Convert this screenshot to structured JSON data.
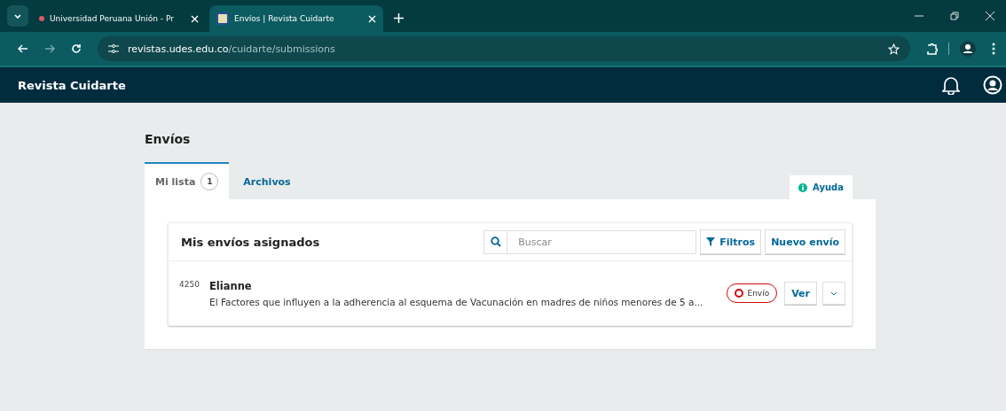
{
  "browser": {
    "tabs": [
      {
        "title": "Universidad Peruana Unión - Pr",
        "selected": false
      },
      {
        "title": "Envíos | Revista Cuidarte",
        "selected": true
      }
    ],
    "url": {
      "host": "revistas.udes.edu.co",
      "path": "/cuidarte/submissions"
    }
  },
  "app": {
    "title": "Revista Cuidarte"
  },
  "page": {
    "title": "Envíos",
    "tabs": [
      {
        "label": "Mi lista",
        "count": "1",
        "selected": true
      },
      {
        "label": "Archivos",
        "selected": false
      }
    ],
    "help": "Ayuda",
    "list": {
      "title": "Mis envíos asignados",
      "search": {
        "placeholder": "Buscar"
      },
      "filters": "Filtros",
      "new": "Nuevo envío",
      "items": [
        {
          "id": "4250",
          "author": "Elianne",
          "title": "El Factores que influyen a la adherencia al esquema de Vacunación en madres de niños menores de 5 a...",
          "stage": "Envío",
          "action": "Ver"
        }
      ]
    }
  }
}
